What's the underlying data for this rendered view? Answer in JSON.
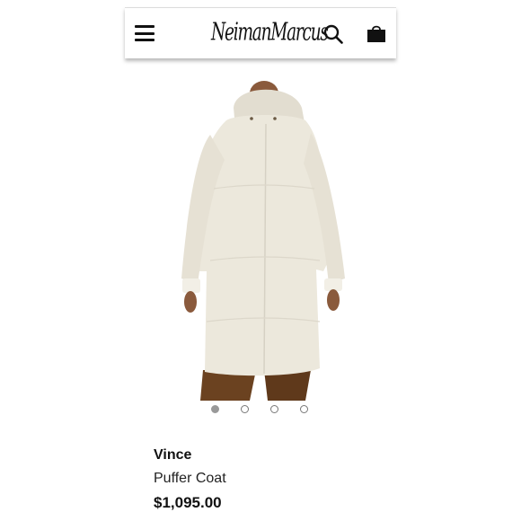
{
  "header": {
    "logo_text": "NeimanMarcus",
    "menu_icon": "hamburger-menu-icon",
    "search_icon": "search-icon",
    "bag_icon": "shopping-bag-icon"
  },
  "gallery": {
    "image_subject": "woman wearing a long cream hooded puffer coat",
    "dot_count": 4,
    "active_index": 0
  },
  "product": {
    "brand": "Vince",
    "name": "Puffer Coat",
    "price": "$1,095.00"
  },
  "colors": {
    "coat": "#ece8dc",
    "trousers": "#6b4220",
    "dot_active": "#999999"
  }
}
